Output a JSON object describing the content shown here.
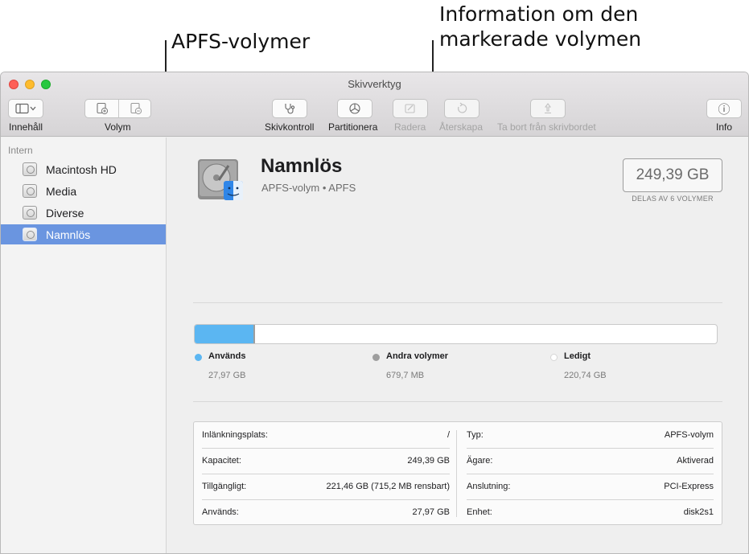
{
  "callouts": {
    "apfs_volumes": "APFS-volymer",
    "info_line1": "Information om den",
    "info_line2": "markerade volymen"
  },
  "window": {
    "title": "Skivverktyg"
  },
  "toolbar": {
    "content_label": "Innehåll",
    "volume_label": "Volym",
    "buttons": [
      {
        "label": "Skivkontroll",
        "icon": "stethoscope-icon",
        "enabled": true
      },
      {
        "label": "Partitionera",
        "icon": "pie-chart-icon",
        "enabled": true
      },
      {
        "label": "Radera",
        "icon": "erase-icon",
        "enabled": false
      },
      {
        "label": "Återskapa",
        "icon": "restore-icon",
        "enabled": false
      },
      {
        "label": "Ta bort från skrivbordet",
        "icon": "unmount-icon",
        "enabled": false
      }
    ],
    "info_label": "Info",
    "info_glyph": "ⓘ"
  },
  "sidebar": {
    "section": "Intern",
    "items": [
      {
        "label": "Macintosh HD",
        "selected": false
      },
      {
        "label": "Media",
        "selected": false
      },
      {
        "label": "Diverse",
        "selected": false
      },
      {
        "label": "Namnlös",
        "selected": true
      }
    ]
  },
  "volume": {
    "name": "Namnlös",
    "subtitle": "APFS-volym • APFS",
    "capacity": "249,39 GB",
    "capacity_note": "DELAS AV 6 VOLYMER"
  },
  "usage": {
    "used_fraction": 0.112,
    "other_fraction": 0.003,
    "legend": [
      {
        "name": "Används",
        "value": "27,97 GB",
        "color": "#5bb6f2"
      },
      {
        "name": "Andra volymer",
        "value": "679,7 MB",
        "color": "#9e9e9e"
      },
      {
        "name": "Ledigt",
        "value": "220,74 GB",
        "color": "#ffffff"
      }
    ]
  },
  "info_table": {
    "left": [
      {
        "key": "Inlänkningsplats:",
        "value": "/"
      },
      {
        "key": "Kapacitet:",
        "value": "249,39 GB"
      },
      {
        "key": "Tillgängligt:",
        "value": "221,46 GB (715,2 MB rensbart)"
      },
      {
        "key": "Används:",
        "value": "27,97 GB"
      }
    ],
    "right": [
      {
        "key": "Typ:",
        "value": "APFS-volym"
      },
      {
        "key": "Ägare:",
        "value": "Aktiverad"
      },
      {
        "key": "Anslutning:",
        "value": "PCI-Express"
      },
      {
        "key": "Enhet:",
        "value": "disk2s1"
      }
    ]
  }
}
